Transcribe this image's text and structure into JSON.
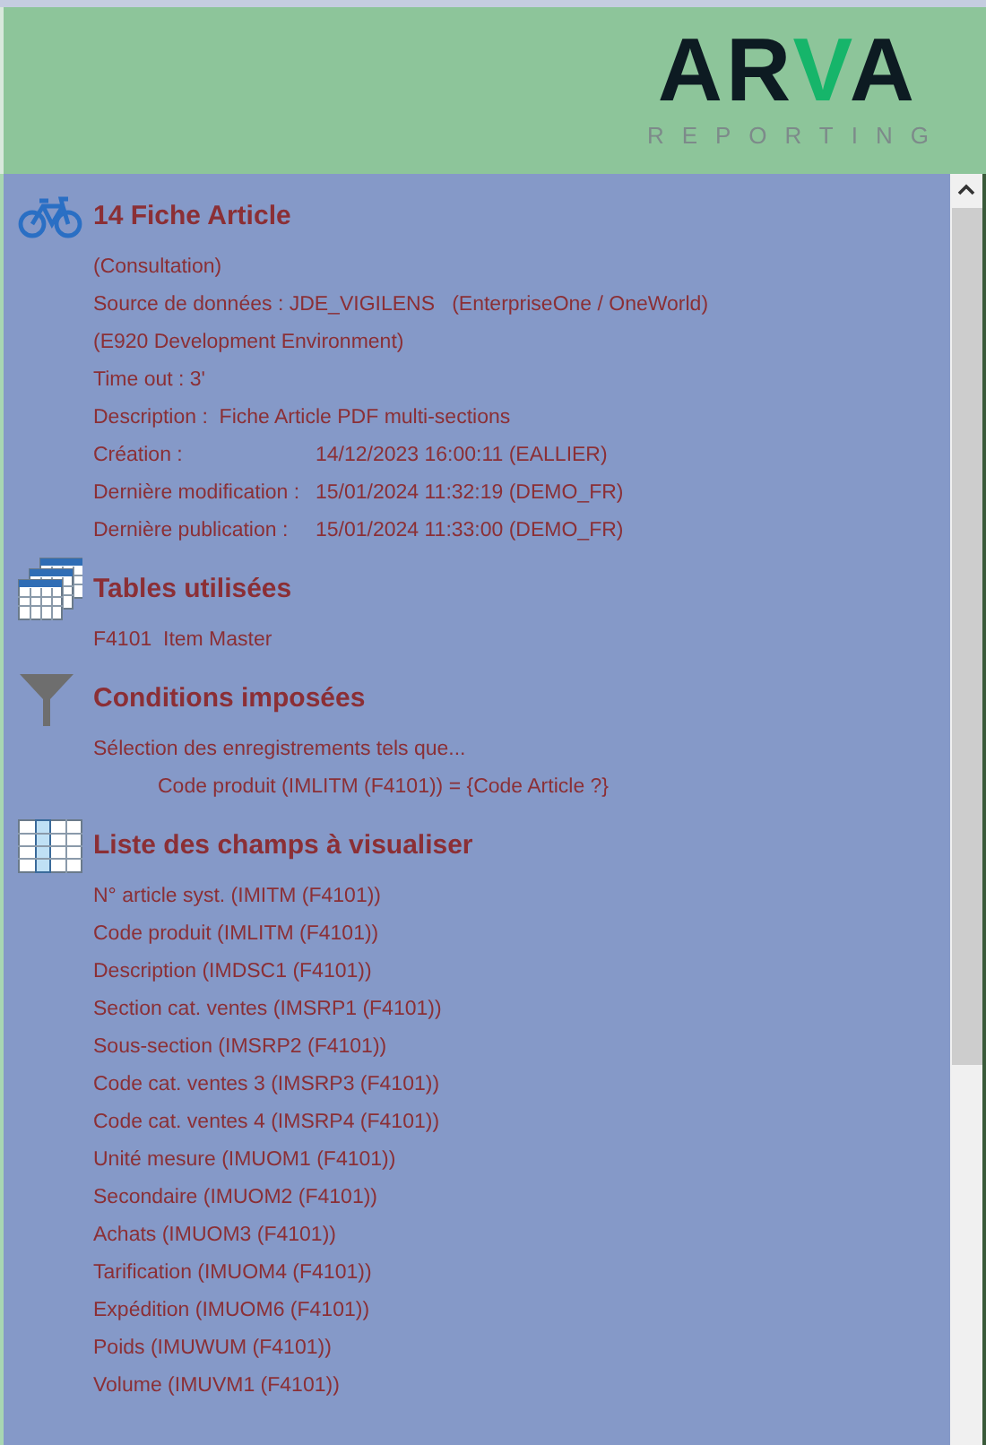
{
  "header": {
    "logo": "ARVA",
    "tagline": "REPORTING"
  },
  "sections": [
    {
      "kind": "bicycle",
      "title": "14 Fiche Article",
      "lines": [
        {
          "kind": "text",
          "text": "(Consultation)"
        },
        {
          "kind": "text",
          "text": "Source de données : JDE_VIGILENS   (EnterpriseOne / OneWorld)"
        },
        {
          "kind": "text",
          "text": "(E920 Development Environment)"
        },
        {
          "kind": "text",
          "text": "Time out : 3'"
        },
        {
          "kind": "text",
          "text": "Description :  Fiche Article PDF multi-sections"
        },
        {
          "kind": "pair",
          "label": "Création :",
          "value": "14/12/2023 16:00:11 (EALLIER)"
        },
        {
          "kind": "pair",
          "label": "Dernière modification :",
          "value": "15/01/2024 11:32:19 (DEMO_FR)"
        },
        {
          "kind": "pair",
          "label": "Dernière publication :",
          "value": "15/01/2024 11:33:00 (DEMO_FR)"
        }
      ]
    },
    {
      "kind": "tables",
      "title": "Tables utilisées",
      "lines": [
        {
          "kind": "text",
          "text": "F4101  Item Master"
        }
      ]
    },
    {
      "kind": "funnel",
      "title": "Conditions imposées",
      "lines": [
        {
          "kind": "text",
          "text": "Sélection des enregistrements tels que..."
        },
        {
          "kind": "indented",
          "text": "Code produit (IMLITM (F4101)) = {Code Article ?}"
        }
      ]
    },
    {
      "kind": "columns",
      "title": "Liste des champs à visualiser",
      "lines": [
        {
          "kind": "text",
          "text": "N° article syst. (IMITM (F4101))"
        },
        {
          "kind": "text",
          "text": "Code produit (IMLITM (F4101))"
        },
        {
          "kind": "text",
          "text": "Description (IMDSC1 (F4101))"
        },
        {
          "kind": "text",
          "text": "Section cat. ventes (IMSRP1 (F4101))"
        },
        {
          "kind": "text",
          "text": "Sous-section (IMSRP2 (F4101))"
        },
        {
          "kind": "text",
          "text": "Code cat. ventes 3 (IMSRP3 (F4101))"
        },
        {
          "kind": "text",
          "text": "Code cat. ventes 4 (IMSRP4 (F4101))"
        },
        {
          "kind": "text",
          "text": "Unité mesure (IMUOM1 (F4101))"
        },
        {
          "kind": "text",
          "text": "Secondaire (IMUOM2 (F4101))"
        },
        {
          "kind": "text",
          "text": "Achats (IMUOM3 (F4101))"
        },
        {
          "kind": "text",
          "text": "Tarification (IMUOM4 (F4101))"
        },
        {
          "kind": "text",
          "text": "Expédition (IMUOM6 (F4101))"
        },
        {
          "kind": "text",
          "text": "Poids (IMUWUM (F4101))"
        },
        {
          "kind": "text",
          "text": "Volume (IMUVM1 (F4101))"
        }
      ]
    }
  ]
}
